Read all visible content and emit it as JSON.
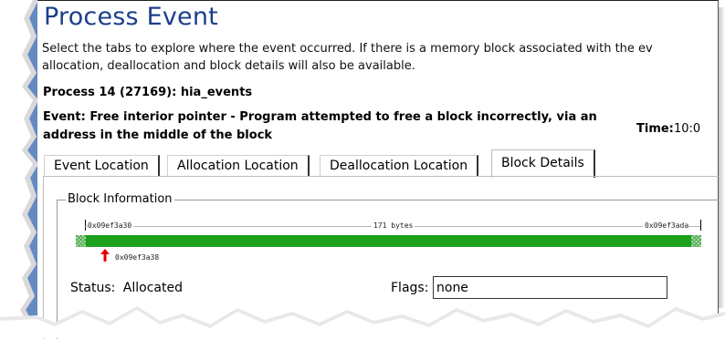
{
  "header": {
    "title": "Process Event",
    "description_line1": "Select the tabs to explore where the event occurred. If there is a memory block associated with the ev",
    "description_line2": "allocation, deallocation and block details will also be available."
  },
  "process": {
    "label": "Process 14 (27169): hia_events"
  },
  "event": {
    "text": "Event: Free interior pointer - Program attempted to free a block incorrectly, via an address in the middle of the block",
    "time_label": "Time:",
    "time_value": "10:0"
  },
  "tabs": [
    {
      "label": "Event Location",
      "active": false
    },
    {
      "label": "Allocation Location",
      "active": false
    },
    {
      "label": "Deallocation Location",
      "active": false
    },
    {
      "label": "Block Details",
      "active": true
    }
  ],
  "block_info": {
    "group_title": "Block Information",
    "start_address": "0x09ef3a30",
    "size_label": "171 bytes",
    "end_address": "0x09ef3ada",
    "pointer_address": "0x09ef3a38",
    "bar_color": "#1ba11b",
    "pointer_icon": "red-up-arrow",
    "status_label": "Status:",
    "status_value": "Allocated",
    "flags_label": "Flags:",
    "flags_value": "none"
  },
  "colors": {
    "title": "#1c3f8a",
    "frame_accent": "#4a74b8"
  }
}
